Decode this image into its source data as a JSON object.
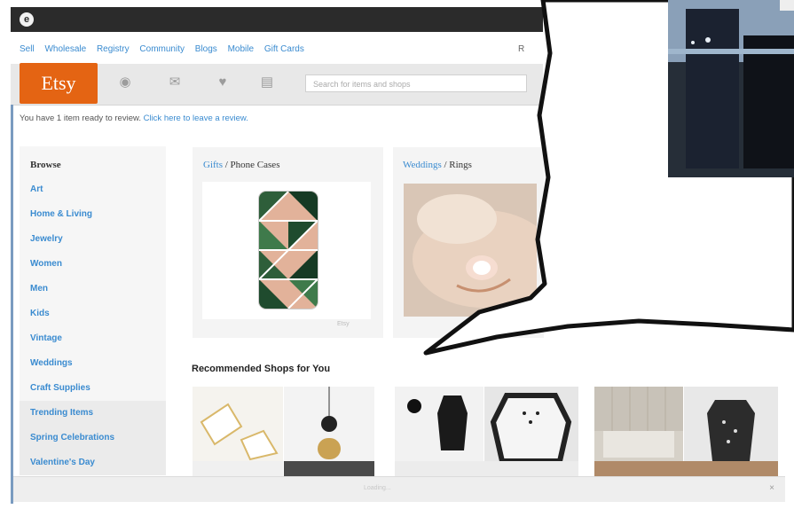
{
  "topbar": {
    "logo": "e"
  },
  "nav": {
    "links": [
      "Sell",
      "Wholesale",
      "Registry",
      "Community",
      "Blogs",
      "Mobile",
      "Gift Cards"
    ],
    "signin": "R"
  },
  "header": {
    "logo": "Etsy",
    "icons": [
      "activity-icon",
      "messages-icon",
      "favorites-icon",
      "cart-icon"
    ],
    "search_placeholder": "Search for items and shops"
  },
  "notice": {
    "text": "You have 1 item ready to review.",
    "link": "Click here to leave a review."
  },
  "sidebar": {
    "title": "Browse",
    "items": [
      "Art",
      "Home & Living",
      "Jewelry",
      "Women",
      "Men",
      "Kids",
      "Vintage",
      "Weddings",
      "Craft Supplies",
      "Trending Items",
      "Spring Celebrations",
      "Valentine's Day"
    ]
  },
  "cards": [
    {
      "category": "Gifts",
      "title": " / Phone Cases"
    },
    {
      "category": "Weddings",
      "title": " / Rings"
    }
  ],
  "card_footer": "Etsy",
  "recommended": {
    "title": "Recommended Shops for You"
  },
  "bottombar": {
    "text": "Loading...",
    "close": "×"
  },
  "colors": {
    "etsy_orange": "#e46413",
    "link_blue": "#3a8bd0",
    "dark_bar": "#2b2b2b"
  }
}
